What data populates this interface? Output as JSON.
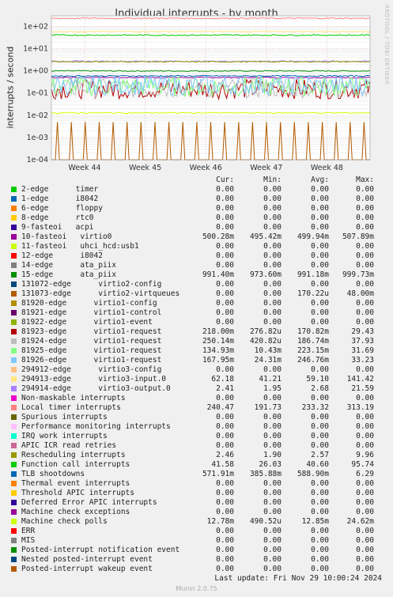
{
  "chart_data": {
    "type": "line",
    "title": "Individual interrupts - by month",
    "ylabel": "interrupts / second",
    "yscale": "log",
    "ylim": [
      0.0001,
      300
    ],
    "yticks": [
      "1e-04",
      "1e-03",
      "1e-02",
      "1e-01",
      "1e+00",
      "1e+01",
      "1e+02"
    ],
    "xticks": [
      "Week 44",
      "Week 45",
      "Week 46",
      "Week 47",
      "Week 48"
    ],
    "grid": true,
    "side_text": "RRDTOOL / TOBI OETIKER",
    "columns": [
      "Cur:",
      "Min:",
      "Avg:",
      "Max:"
    ],
    "series": [
      {
        "name": "2-edge      timer",
        "color": "#00cc00",
        "cur": "0.00",
        "min": "0.00",
        "avg": "0.00",
        "max": "0.00"
      },
      {
        "name": "1-edge      i8042",
        "color": "#0066b3",
        "cur": "0.00",
        "min": "0.00",
        "avg": "0.00",
        "max": "0.00"
      },
      {
        "name": "6-edge      floppy",
        "color": "#ff8000",
        "cur": "0.00",
        "min": "0.00",
        "avg": "0.00",
        "max": "0.00"
      },
      {
        "name": "8-edge      rtc0",
        "color": "#ffcc00",
        "cur": "0.00",
        "min": "0.00",
        "avg": "0.00",
        "max": "0.00"
      },
      {
        "name": "9-fasteoi   acpi",
        "color": "#330099",
        "cur": "0.00",
        "min": "0.00",
        "avg": "0.00",
        "max": "0.00"
      },
      {
        "name": "10-fasteoi   virtio0",
        "color": "#990099",
        "cur": "500.28m",
        "min": "495.42m",
        "avg": "499.94m",
        "max": "507.89m"
      },
      {
        "name": "11-fasteoi   uhci_hcd:usb1",
        "color": "#ccff00",
        "cur": "0.00",
        "min": "0.00",
        "avg": "0.00",
        "max": "0.00"
      },
      {
        "name": "12-edge      i8042",
        "color": "#ff0000",
        "cur": "0.00",
        "min": "0.00",
        "avg": "0.00",
        "max": "0.00"
      },
      {
        "name": "14-edge      ata_piix",
        "color": "#808080",
        "cur": "0.00",
        "min": "0.00",
        "avg": "0.00",
        "max": "0.00"
      },
      {
        "name": "15-edge      ata_piix",
        "color": "#008f00",
        "cur": "991.40m",
        "min": "973.60m",
        "avg": "991.18m",
        "max": "999.73m"
      },
      {
        "name": "131072-edge      virtio2-config",
        "color": "#00487d",
        "cur": "0.00",
        "min": "0.00",
        "avg": "0.00",
        "max": "0.00"
      },
      {
        "name": "131073-edge      virtio2-virtqueues",
        "color": "#b35a00",
        "cur": "0.00",
        "min": "0.00",
        "avg": "170.22u",
        "max": "48.00m"
      },
      {
        "name": "81920-edge      virtio1-config",
        "color": "#b38f00",
        "cur": "0.00",
        "min": "0.00",
        "avg": "0.00",
        "max": "0.00"
      },
      {
        "name": "81921-edge      virtio1-control",
        "color": "#6b006b",
        "cur": "0.00",
        "min": "0.00",
        "avg": "0.00",
        "max": "0.00"
      },
      {
        "name": "81922-edge      virtio1-event",
        "color": "#8fb300",
        "cur": "0.00",
        "min": "0.00",
        "avg": "0.00",
        "max": "0.00"
      },
      {
        "name": "81923-edge      virtio1-request",
        "color": "#b30000",
        "cur": "218.00m",
        "min": "276.82u",
        "avg": "170.82m",
        "max": "29.43"
      },
      {
        "name": "81924-edge      virtio1-request",
        "color": "#bebebe",
        "cur": "250.14m",
        "min": "420.82u",
        "avg": "186.74m",
        "max": "37.93"
      },
      {
        "name": "81925-edge      virtio1-request",
        "color": "#80ff80",
        "cur": "134.93m",
        "min": "10.43m",
        "avg": "223.15m",
        "max": "31.69"
      },
      {
        "name": "81926-edge      virtio1-request",
        "color": "#80c9ff",
        "cur": "167.95m",
        "min": "24.31m",
        "avg": "246.76m",
        "max": "33.23"
      },
      {
        "name": "294912-edge      virtio3-config",
        "color": "#ffc080",
        "cur": "0.00",
        "min": "0.00",
        "avg": "0.00",
        "max": "0.00"
      },
      {
        "name": "294913-edge      virtio3-input.0",
        "color": "#ffe680",
        "cur": "62.18",
        "min": "41.21",
        "avg": "59.10",
        "max": "141.42"
      },
      {
        "name": "294914-edge      virtio3-output.0",
        "color": "#aa80ff",
        "cur": "2.41",
        "min": "1.95",
        "avg": "2.68",
        "max": "21.59"
      },
      {
        "name": "Non-maskable interrupts",
        "color": "#ee00cc",
        "cur": "0.00",
        "min": "0.00",
        "avg": "0.00",
        "max": "0.00"
      },
      {
        "name": "Local timer interrupts",
        "color": "#ff8080",
        "cur": "240.47",
        "min": "191.73",
        "avg": "233.32",
        "max": "313.19"
      },
      {
        "name": "Spurious interrupts",
        "color": "#666600",
        "cur": "0.00",
        "min": "0.00",
        "avg": "0.00",
        "max": "0.00"
      },
      {
        "name": "Performance monitoring interrupts",
        "color": "#ffbfff",
        "cur": "0.00",
        "min": "0.00",
        "avg": "0.00",
        "max": "0.00"
      },
      {
        "name": "IRQ work interrupts",
        "color": "#00ffcc",
        "cur": "0.00",
        "min": "0.00",
        "avg": "0.00",
        "max": "0.00"
      },
      {
        "name": "APIC ICR read retries",
        "color": "#cc6699",
        "cur": "0.00",
        "min": "0.00",
        "avg": "0.00",
        "max": "0.00"
      },
      {
        "name": "Rescheduling interrupts",
        "color": "#999900",
        "cur": "2.46",
        "min": "1.90",
        "avg": "2.57",
        "max": "9.96"
      },
      {
        "name": "Function call interrupts",
        "color": "#00cc00",
        "cur": "41.58",
        "min": "26.03",
        "avg": "40.60",
        "max": "95.74"
      },
      {
        "name": "TLB shootdowns",
        "color": "#0066b3",
        "cur": "571.91m",
        "min": "385.88m",
        "avg": "588.90m",
        "max": "6.29"
      },
      {
        "name": "Thermal event interrupts",
        "color": "#ff8000",
        "cur": "0.00",
        "min": "0.00",
        "avg": "0.00",
        "max": "0.00"
      },
      {
        "name": "Threshold APIC interrupts",
        "color": "#ffcc00",
        "cur": "0.00",
        "min": "0.00",
        "avg": "0.00",
        "max": "0.00"
      },
      {
        "name": "Deferred Error APIC interrupts",
        "color": "#330099",
        "cur": "0.00",
        "min": "0.00",
        "avg": "0.00",
        "max": "0.00"
      },
      {
        "name": "Machine check exceptions",
        "color": "#990099",
        "cur": "0.00",
        "min": "0.00",
        "avg": "0.00",
        "max": "0.00"
      },
      {
        "name": "Machine check polls",
        "color": "#ccff00",
        "cur": "12.78m",
        "min": "490.52u",
        "avg": "12.85m",
        "max": "24.62m"
      },
      {
        "name": "ERR",
        "color": "#ff0000",
        "cur": "0.00",
        "min": "0.00",
        "avg": "0.00",
        "max": "0.00"
      },
      {
        "name": "MIS",
        "color": "#808080",
        "cur": "0.00",
        "min": "0.00",
        "avg": "0.00",
        "max": "0.00"
      },
      {
        "name": "Posted-interrupt notification event",
        "color": "#008f00",
        "cur": "0.00",
        "min": "0.00",
        "avg": "0.00",
        "max": "0.00"
      },
      {
        "name": "Nested posted-interrupt event",
        "color": "#00487d",
        "cur": "0.00",
        "min": "0.00",
        "avg": "0.00",
        "max": "0.00"
      },
      {
        "name": "Posted-interrupt wakeup event",
        "color": "#b35a00",
        "cur": "0.00",
        "min": "0.00",
        "avg": "0.00",
        "max": "0.00"
      }
    ]
  },
  "footer": {
    "last_update": "Last update: Fri Nov 29 10:00:24 2024",
    "munin": "Munin 2.0.75"
  }
}
